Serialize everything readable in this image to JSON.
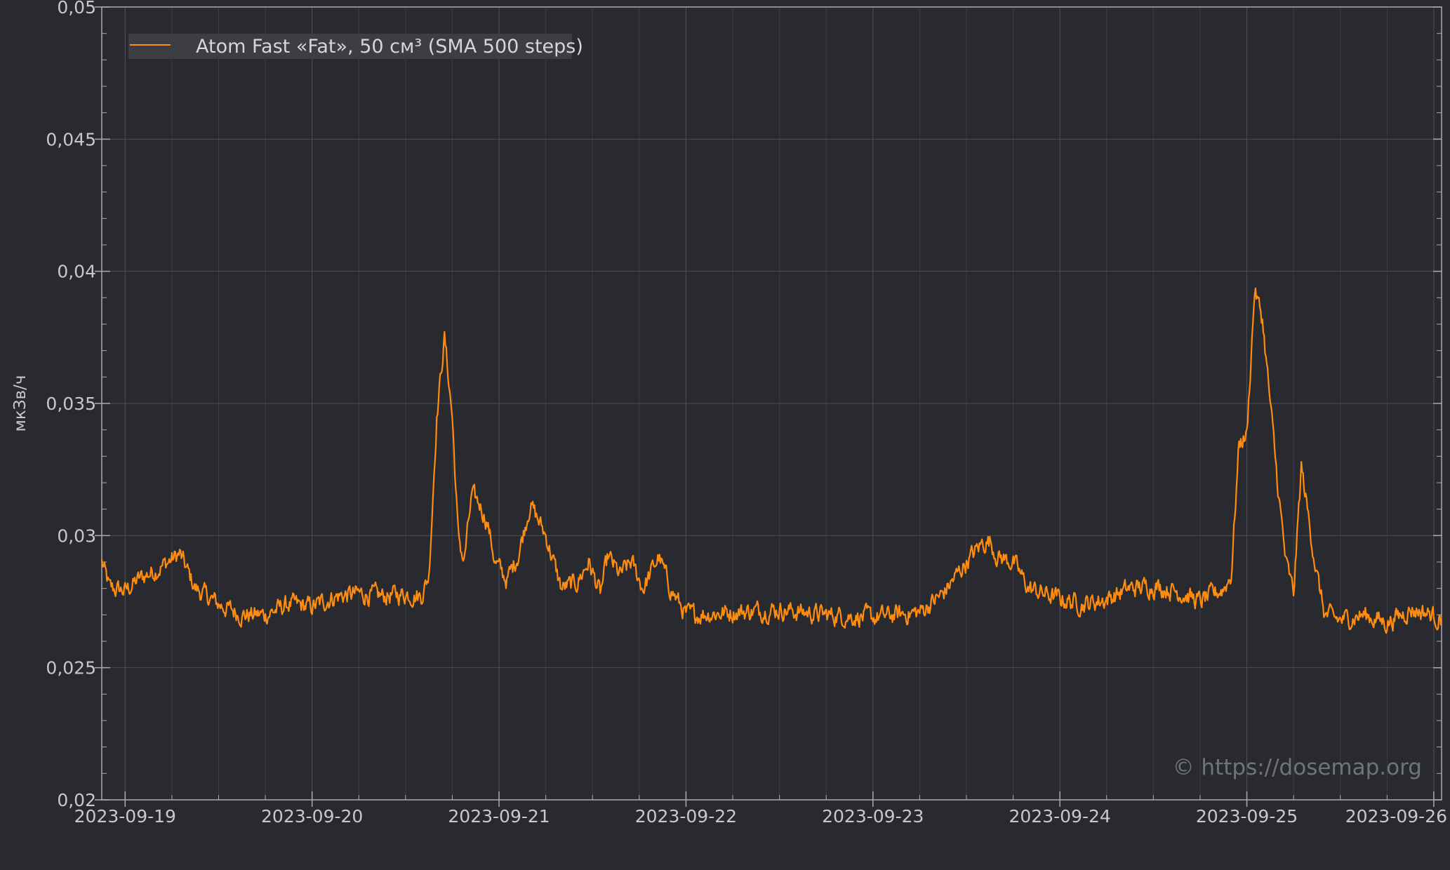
{
  "colors": {
    "background": "#282a30",
    "plot_background": "#282a30",
    "grid_major": "#4c4f57",
    "grid_minor": "#3a3d44",
    "axis": "#a9abb0",
    "series": "#ff8c0f",
    "text": "#c8c8c8",
    "legend_bg": "#3c3e44",
    "watermark": "#70737a"
  },
  "watermark": "© https://dosemap.org",
  "chart_data": {
    "type": "line",
    "ylabel": "мкЗв/ч",
    "ylim": [
      0.02,
      0.05
    ],
    "xlim": [
      "2023-09-18T21:00",
      "2023-09-26T01:00"
    ],
    "grid": true,
    "legend_position": "top-left",
    "y_ticks": [
      {
        "value": 0.02,
        "label": "0,02"
      },
      {
        "value": 0.025,
        "label": "0,025"
      },
      {
        "value": 0.03,
        "label": "0,03"
      },
      {
        "value": 0.035,
        "label": "0,035"
      },
      {
        "value": 0.04,
        "label": "0,04"
      },
      {
        "value": 0.045,
        "label": "0,045"
      },
      {
        "value": 0.05,
        "label": "0,05"
      }
    ],
    "x_ticks": [
      {
        "value": "2023-09-19T00:00",
        "label": "2023-09-19"
      },
      {
        "value": "2023-09-20T00:00",
        "label": "2023-09-20"
      },
      {
        "value": "2023-09-21T00:00",
        "label": "2023-09-21"
      },
      {
        "value": "2023-09-22T00:00",
        "label": "2023-09-22"
      },
      {
        "value": "2023-09-23T00:00",
        "label": "2023-09-23"
      },
      {
        "value": "2023-09-24T00:00",
        "label": "2023-09-24"
      },
      {
        "value": "2023-09-25T00:00",
        "label": "2023-09-25"
      },
      {
        "value": "2023-09-26T00:00",
        "label": "2023-09-26"
      }
    ],
    "series": [
      {
        "name": "Atom Fast «Fat», 50 см³ (SMA 500 steps)",
        "color": "#ff8c0f",
        "points": [
          [
            "2023-09-18T21:00",
            0.029
          ],
          [
            "2023-09-18T22:00",
            0.028
          ],
          [
            "2023-09-19T00:00",
            0.0279
          ],
          [
            "2023-09-19T02:00",
            0.0284
          ],
          [
            "2023-09-19T04:00",
            0.0287
          ],
          [
            "2023-09-19T06:00",
            0.0291
          ],
          [
            "2023-09-19T07:00",
            0.0293
          ],
          [
            "2023-09-19T09:00",
            0.028
          ],
          [
            "2023-09-19T12:00",
            0.0274
          ],
          [
            "2023-09-19T15:00",
            0.027
          ],
          [
            "2023-09-19T18:00",
            0.027
          ],
          [
            "2023-09-19T21:00",
            0.0274
          ],
          [
            "2023-09-20T00:00",
            0.0273
          ],
          [
            "2023-09-20T03:00",
            0.0277
          ],
          [
            "2023-09-20T06:00",
            0.0278
          ],
          [
            "2023-09-20T09:00",
            0.0277
          ],
          [
            "2023-09-20T12:00",
            0.0278
          ],
          [
            "2023-09-20T14:00",
            0.0277
          ],
          [
            "2023-09-20T15:00",
            0.0285
          ],
          [
            "2023-09-20T16:00",
            0.0345
          ],
          [
            "2023-09-20T17:00",
            0.0375
          ],
          [
            "2023-09-20T18:00",
            0.0345
          ],
          [
            "2023-09-20T18:45",
            0.03
          ],
          [
            "2023-09-20T19:30",
            0.029
          ],
          [
            "2023-09-20T20:30",
            0.0315
          ],
          [
            "2023-09-20T21:30",
            0.0312
          ],
          [
            "2023-09-20T22:30",
            0.0305
          ],
          [
            "2023-09-20T23:30",
            0.029
          ],
          [
            "2023-09-21T01:00",
            0.0283
          ],
          [
            "2023-09-21T02:30",
            0.0293
          ],
          [
            "2023-09-21T04:00",
            0.0312
          ],
          [
            "2023-09-21T06:00",
            0.03
          ],
          [
            "2023-09-21T08:00",
            0.028
          ],
          [
            "2023-09-21T10:00",
            0.0282
          ],
          [
            "2023-09-21T11:30",
            0.029
          ],
          [
            "2023-09-21T13:00",
            0.0278
          ],
          [
            "2023-09-21T14:00",
            0.0292
          ],
          [
            "2023-09-21T15:30",
            0.0285
          ],
          [
            "2023-09-21T17:00",
            0.029
          ],
          [
            "2023-09-21T18:30",
            0.028
          ],
          [
            "2023-09-21T20:30",
            0.0292
          ],
          [
            "2023-09-21T22:00",
            0.028
          ],
          [
            "2023-09-22T00:00",
            0.027
          ],
          [
            "2023-09-22T06:00",
            0.0271
          ],
          [
            "2023-09-22T12:00",
            0.0272
          ],
          [
            "2023-09-22T18:00",
            0.027
          ],
          [
            "2023-09-23T00:00",
            0.0269
          ],
          [
            "2023-09-23T06:00",
            0.0271
          ],
          [
            "2023-09-23T09:00",
            0.0278
          ],
          [
            "2023-09-23T12:00",
            0.029
          ],
          [
            "2023-09-23T14:00",
            0.0297
          ],
          [
            "2023-09-23T15:00",
            0.0298
          ],
          [
            "2023-09-23T16:00",
            0.0292
          ],
          [
            "2023-09-23T18:00",
            0.029
          ],
          [
            "2023-09-23T20:00",
            0.028
          ],
          [
            "2023-09-24T00:00",
            0.0276
          ],
          [
            "2023-09-24T03:00",
            0.0274
          ],
          [
            "2023-09-24T06:00",
            0.0276
          ],
          [
            "2023-09-24T09:00",
            0.028
          ],
          [
            "2023-09-24T12:00",
            0.0281
          ],
          [
            "2023-09-24T15:00",
            0.0279
          ],
          [
            "2023-09-24T18:00",
            0.0275
          ],
          [
            "2023-09-24T21:00",
            0.028
          ],
          [
            "2023-09-24T22:00",
            0.0285
          ],
          [
            "2023-09-24T23:00",
            0.0335
          ],
          [
            "2023-09-25T00:00",
            0.0338
          ],
          [
            "2023-09-25T01:00",
            0.0393
          ],
          [
            "2023-09-25T02:00",
            0.0382
          ],
          [
            "2023-09-25T03:00",
            0.035
          ],
          [
            "2023-09-25T04:00",
            0.0318
          ],
          [
            "2023-09-25T05:00",
            0.029
          ],
          [
            "2023-09-25T06:00",
            0.0278
          ],
          [
            "2023-09-25T07:00",
            0.0326
          ],
          [
            "2023-09-25T08:00",
            0.0305
          ],
          [
            "2023-09-25T09:00",
            0.0285
          ],
          [
            "2023-09-25T10:00",
            0.027
          ],
          [
            "2023-09-25T12:00",
            0.0268
          ],
          [
            "2023-09-25T15:00",
            0.027
          ],
          [
            "2023-09-25T18:00",
            0.0267
          ],
          [
            "2023-09-25T21:00",
            0.0272
          ],
          [
            "2023-09-25T23:00",
            0.0271
          ],
          [
            "2023-09-26T01:00",
            0.0268
          ]
        ]
      }
    ]
  }
}
